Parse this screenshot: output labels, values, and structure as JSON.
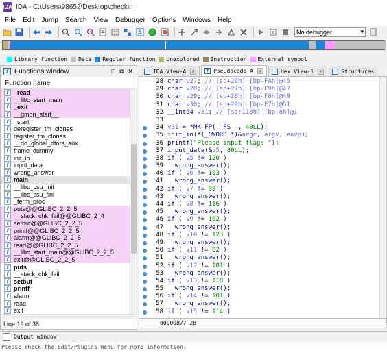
{
  "window": {
    "title": "IDA - C:\\Users\\98652\\Desktop\\checkin",
    "app_icon": "ida-icon"
  },
  "menu": [
    "File",
    "Edit",
    "Jump",
    "Search",
    "View",
    "Debugger",
    "Options",
    "Windows",
    "Help"
  ],
  "toolbar": {
    "debugger_select": "No debugger"
  },
  "colors": {
    "library_function": "#00ffff",
    "data": "#c0c0c0",
    "regular_function": "#1a86d8",
    "unexplored": "#b4b46e",
    "instruction": "#a08060",
    "external_symbol": "#ff99ff"
  },
  "legend": [
    {
      "label": "Library function",
      "color": "#00ffff"
    },
    {
      "label": "Data",
      "color": "#c0c0c0"
    },
    {
      "label": "Regular function",
      "color": "#1a86d8"
    },
    {
      "label": "Unexplored",
      "color": "#b4b46e"
    },
    {
      "label": "Instruction",
      "color": "#a08060"
    },
    {
      "label": "External symbol",
      "color": "#ff99ff"
    }
  ],
  "functions_window": {
    "title": "Functions window",
    "column_header": "Function name",
    "status": "Line 19 of 38",
    "items": [
      {
        "name": "_read",
        "type": "lib",
        "bold": true
      },
      {
        "name": "__libc_start_main",
        "type": "lib",
        "bold": false
      },
      {
        "name": "_exit",
        "type": "lib",
        "bold": true
      },
      {
        "name": "__gmon_start__",
        "type": "lib",
        "bold": false
      },
      {
        "name": "_start",
        "type": "normal",
        "bold": false
      },
      {
        "name": "deregister_tm_clones",
        "type": "normal",
        "bold": false
      },
      {
        "name": "register_tm_clones",
        "type": "normal",
        "bold": false
      },
      {
        "name": "__do_global_dtors_aux",
        "type": "normal",
        "bold": false
      },
      {
        "name": "frame_dummy",
        "type": "normal",
        "bold": false
      },
      {
        "name": "init_io",
        "type": "normal",
        "bold": false
      },
      {
        "name": "input_data",
        "type": "normal",
        "bold": false
      },
      {
        "name": "wrong_answer",
        "type": "normal",
        "bold": false
      },
      {
        "name": "main",
        "type": "sel",
        "bold": true
      },
      {
        "name": "__libc_csu_init",
        "type": "normal",
        "bold": false
      },
      {
        "name": "__libc_csu_fini",
        "type": "normal",
        "bold": false
      },
      {
        "name": "_term_proc",
        "type": "normal",
        "bold": false
      },
      {
        "name": "puts@@GLIBC_2_2_5",
        "type": "lib",
        "bold": false
      },
      {
        "name": "__stack_chk_fail@@GLIBC_2_4",
        "type": "lib",
        "bold": false
      },
      {
        "name": "setbuf@@GLIBC_2_2_5",
        "type": "lib",
        "bold": false
      },
      {
        "name": "printf@@GLIBC_2_2_5",
        "type": "lib",
        "bold": false
      },
      {
        "name": "alarm@@GLIBC_2_2_5",
        "type": "lib",
        "bold": false
      },
      {
        "name": "read@@GLIBC_2_2_5",
        "type": "lib",
        "bold": false
      },
      {
        "name": "__libc_start_main@@GLIBC_2_2_5",
        "type": "lib",
        "bold": false
      },
      {
        "name": "exit@@GLIBC_2_2_5",
        "type": "lib",
        "bold": false
      },
      {
        "name": "puts",
        "type": "normal",
        "bold": true
      },
      {
        "name": "__stack_chk_fail",
        "type": "normal",
        "bold": false
      },
      {
        "name": "setbuf",
        "type": "normal",
        "bold": true
      },
      {
        "name": "printf",
        "type": "normal",
        "bold": true
      },
      {
        "name": "alarm",
        "type": "normal",
        "bold": false
      },
      {
        "name": "read",
        "type": "normal",
        "bold": false
      },
      {
        "name": "exit",
        "type": "normal",
        "bold": false
      }
    ]
  },
  "tabs": [
    {
      "label": "IDA View-A",
      "active": false,
      "icon": "ida-view-icon"
    },
    {
      "label": "Pseudocode-A",
      "active": true,
      "icon": "pseudocode-icon"
    },
    {
      "label": "Hex View-1",
      "active": false,
      "icon": "hex-icon"
    },
    {
      "label": "Structures",
      "active": false,
      "icon": "struct-icon"
    }
  ],
  "pseudocode": {
    "lines": [
      {
        "n": "28",
        "dot": false,
        "code": "char v27; // [sp+26h] [bp-FAh]@45"
      },
      {
        "n": "29",
        "dot": false,
        "code": "char v28; // [sp+27h] [bp-F9h]@47"
      },
      {
        "n": "30",
        "dot": false,
        "code": "char v29; // [sp+28h] [bp-F8h]@49"
      },
      {
        "n": "31",
        "dot": false,
        "code": "char v30; // [sp+29h] [bp-F7h]@51"
      },
      {
        "n": "32",
        "dot": false,
        "code": "__int64 v31; // [sp+118h] [bp-8h]@1"
      },
      {
        "n": "33",
        "dot": false,
        "code": ""
      },
      {
        "n": "34",
        "dot": true,
        "code": "v31 = *MK_FP(__FS__, 40LL);"
      },
      {
        "n": "35",
        "dot": true,
        "code": "init_io(*(_QWORD *)&argc, argv, envp);"
      },
      {
        "n": "36",
        "dot": true,
        "code": "printf(\"Please input flag: \");"
      },
      {
        "n": "37",
        "dot": true,
        "code": "input_data(&v5, 80LL);"
      },
      {
        "n": "38",
        "dot": true,
        "code": "if ( v5 != 120 )"
      },
      {
        "n": "39",
        "dot": true,
        "code": "  wrong_answer();"
      },
      {
        "n": "40",
        "dot": true,
        "code": "if ( v6 != 103 )"
      },
      {
        "n": "41",
        "dot": true,
        "code": "  wrong_answer();"
      },
      {
        "n": "42",
        "dot": true,
        "code": "if ( v7 != 99 )"
      },
      {
        "n": "43",
        "dot": true,
        "code": "  wrong_answer();"
      },
      {
        "n": "44",
        "dot": true,
        "code": "if ( v8 != 116 )"
      },
      {
        "n": "45",
        "dot": true,
        "code": "  wrong_answer();"
      },
      {
        "n": "46",
        "dot": true,
        "code": "if ( v9 != 102 )"
      },
      {
        "n": "47",
        "dot": true,
        "code": "  wrong_answer();"
      },
      {
        "n": "48",
        "dot": true,
        "code": "if ( v10 != 123 )"
      },
      {
        "n": "49",
        "dot": true,
        "code": "  wrong_answer();"
      },
      {
        "n": "50",
        "dot": true,
        "code": "if ( v11 != 82 )"
      },
      {
        "n": "51",
        "dot": true,
        "code": "  wrong_answer();"
      },
      {
        "n": "52",
        "dot": true,
        "code": "if ( v12 != 101 )"
      },
      {
        "n": "53",
        "dot": true,
        "code": "  wrong_answer();"
      },
      {
        "n": "54",
        "dot": true,
        "code": "if ( v13 != 118 )"
      },
      {
        "n": "55",
        "dot": true,
        "code": "  wrong_answer();"
      },
      {
        "n": "56",
        "dot": true,
        "code": "if ( v14 != 101 )"
      },
      {
        "n": "57",
        "dot": true,
        "code": "  wrong_answer();"
      },
      {
        "n": "58",
        "dot": true,
        "code": "if ( v15 != 114 )"
      }
    ],
    "address": "00000877 28"
  },
  "output": {
    "title": "Output window",
    "line": "Please check the Edit/Plugins menu for more information."
  }
}
